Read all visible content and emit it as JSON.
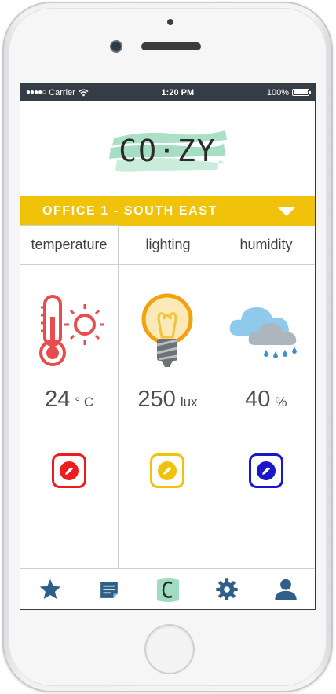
{
  "status_bar": {
    "signal": "●●●●○",
    "carrier": "Carrier",
    "time": "1:20 PM",
    "battery": "100%",
    "battery_level": 1.0
  },
  "app": {
    "logo": "CO·ZY"
  },
  "room_selector": {
    "selected": "OFFICE 1 - SOUTH EAST"
  },
  "tabs": [
    {
      "label": "temperature",
      "active": true
    },
    {
      "label": "lighting",
      "active": false
    },
    {
      "label": "humidity",
      "active": false
    }
  ],
  "sensors": {
    "temperature": {
      "value": "24",
      "unit": "° C",
      "icon": "thermometer-sun-icon",
      "color": "#e84c4c"
    },
    "lighting": {
      "value": "250",
      "unit": "lux",
      "icon": "light-bulb-icon",
      "color": "#f2a20c"
    },
    "humidity": {
      "value": "40",
      "unit": "%",
      "icon": "rain-cloud-icon",
      "color": "#4fa3d8"
    }
  },
  "edit_buttons": {
    "temperature": {
      "border": "#ee1c1c",
      "fill": "#ee1c1c"
    },
    "lighting": {
      "border": "#f2c20a",
      "fill": "#f2c20a"
    },
    "humidity": {
      "border": "#1a17c8",
      "fill": "#1a17c8"
    }
  },
  "bottom_nav": [
    "star-icon",
    "notes-icon",
    "cozy-logo-icon",
    "gear-icon",
    "user-icon"
  ],
  "colors": {
    "accent": "#f0c20a",
    "nav_icons": "#2f5f86",
    "status_bar": "#343c45"
  }
}
